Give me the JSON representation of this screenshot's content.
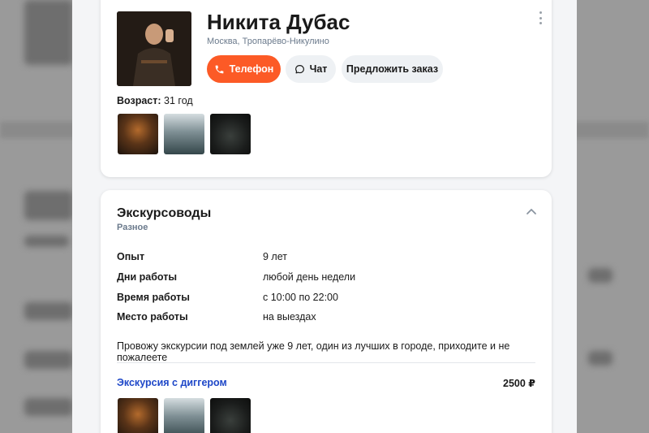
{
  "profile": {
    "name": "Никита Дубас",
    "location": "Москва, Тропарёво-Никулино",
    "age_label": "Возраст:",
    "age_value": "31 год",
    "buttons": {
      "phone": "Телефон",
      "chat": "Чат",
      "offer": "Предложить заказ"
    }
  },
  "category": {
    "title": "Экскурсоводы",
    "subtitle": "Разное",
    "details": [
      {
        "key": "Опыт",
        "value": "9 лет"
      },
      {
        "key": "Дни работы",
        "value": "любой день недели"
      },
      {
        "key": "Время работы",
        "value": "с 10:00 по 22:00"
      },
      {
        "key": "Место работы",
        "value": "на выездах"
      }
    ],
    "description": "Провожу экскурсии под землей уже 9 лет, один из лучших в городе, приходите и не пожалеете",
    "service": {
      "name": "Экскурсия с диггером",
      "price": "2500 ₽"
    }
  },
  "icons": [
    "phone-icon",
    "chat-icon",
    "more-vert-icon",
    "chevron-up-icon"
  ],
  "colors": {
    "accent": "#fc5a26",
    "link": "#1e47c8",
    "muted": "#6b7a8c"
  }
}
